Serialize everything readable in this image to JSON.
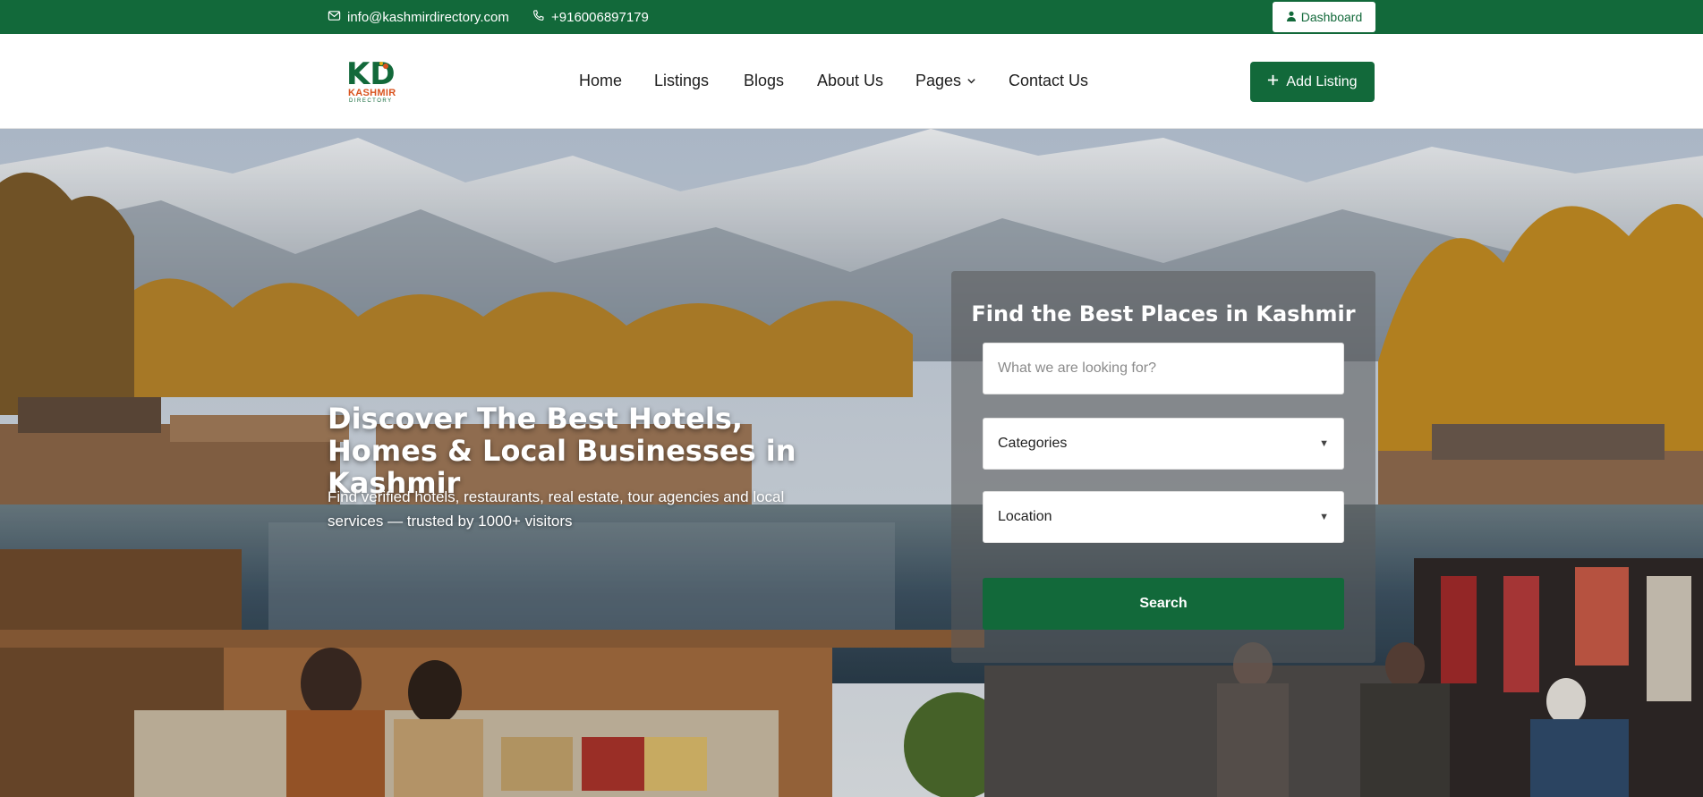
{
  "topbar": {
    "email": "info@kashmirdirectory.com",
    "phone": "+916006897179",
    "dashboard_label": "Dashboard",
    "icons": [
      "envelope-icon",
      "phone-icon",
      "user-icon"
    ]
  },
  "brand": {
    "logo_letters": "KD",
    "logo_word": "KASHMIR",
    "logo_sub": "DIRECTORY"
  },
  "nav": {
    "items": [
      {
        "label": "Home"
      },
      {
        "label": "Listings"
      },
      {
        "label": "Blogs"
      },
      {
        "label": "About Us"
      },
      {
        "label": "Pages"
      },
      {
        "label": "Contact Us"
      }
    ],
    "add_listing_label": "Add Listing"
  },
  "hero": {
    "title": "Discover The Best Hotels, Homes & Local Businesses in Kashmir",
    "subtitle": "Find verified hotels, restaurants, real estate, tour agencies and local services — trusted by 1000+ visitors"
  },
  "search": {
    "title": "Find the Best Places in Kashmir",
    "placeholder": "What we are looking for?",
    "categories_label": "Categories",
    "location_label": "Location",
    "button_label": "Search"
  },
  "colors": {
    "brand_green": "#12693a",
    "accent_orange": "#d9531e"
  }
}
